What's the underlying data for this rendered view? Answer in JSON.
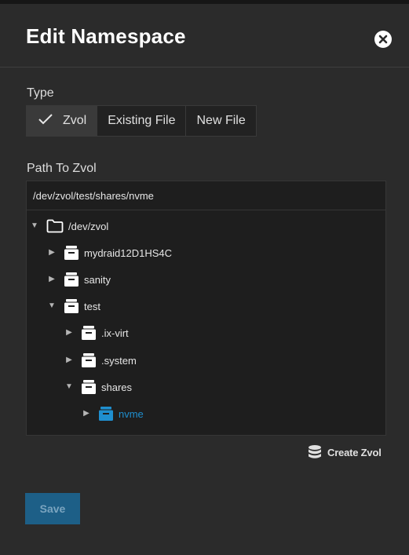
{
  "dialog": {
    "title": "Edit Namespace"
  },
  "type_field": {
    "label": "Type",
    "options": [
      {
        "label": "Zvol",
        "selected": true
      },
      {
        "label": "Existing File",
        "selected": false
      },
      {
        "label": "New File",
        "selected": false
      }
    ]
  },
  "path_field": {
    "label": "Path To Zvol",
    "value": "/dev/zvol/test/shares/nvme"
  },
  "tree": {
    "root": {
      "label": "/dev/zvol",
      "icon": "folder-icon",
      "expanded": true
    },
    "nodes": [
      {
        "label": "mydraid12D1HS4C",
        "icon": "dataset-icon",
        "expanded": false
      },
      {
        "label": "sanity",
        "icon": "dataset-icon",
        "expanded": false
      },
      {
        "label": "test",
        "icon": "dataset-icon",
        "expanded": true
      },
      {
        "label": ".ix-virt",
        "icon": "dataset-icon",
        "expanded": false
      },
      {
        "label": ".system",
        "icon": "dataset-icon",
        "expanded": false
      },
      {
        "label": "shares",
        "icon": "dataset-icon",
        "expanded": true
      },
      {
        "label": "nvme",
        "icon": "dataset-icon",
        "expanded": false,
        "selected": true
      }
    ]
  },
  "actions": {
    "create_zvol": "Create Zvol",
    "save": "Save"
  },
  "colors": {
    "background": "#2b2b2b",
    "selected_node": "#1f8fcf",
    "save_button": "#1d5f87"
  }
}
